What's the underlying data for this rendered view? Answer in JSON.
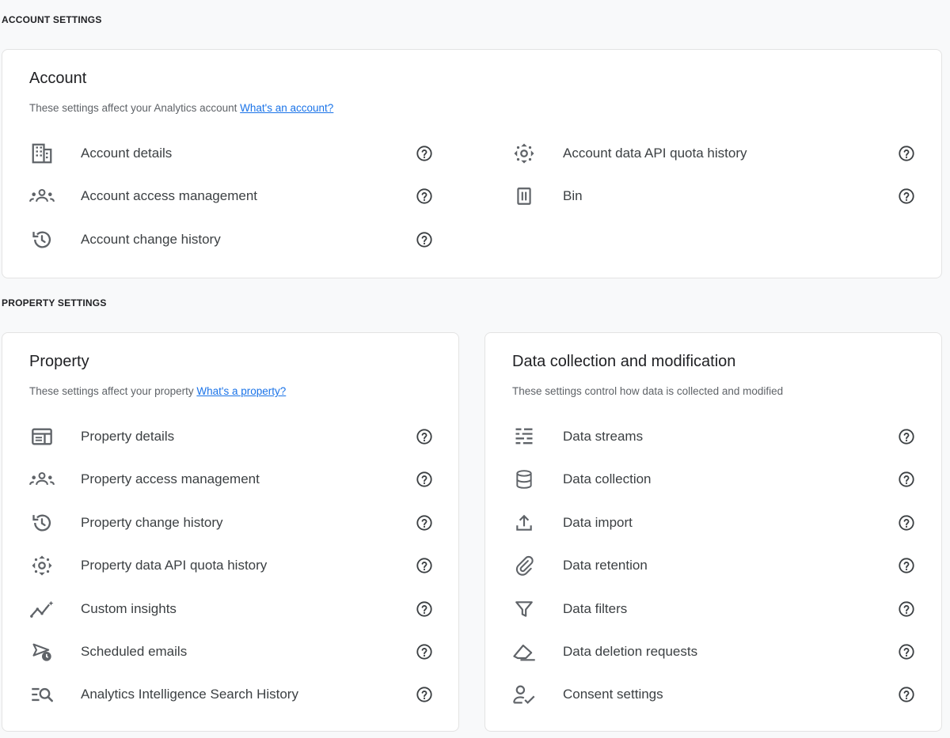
{
  "account_section": {
    "label": "ACCOUNT SETTINGS",
    "card": {
      "title": "Account",
      "subtitle": "These settings affect your Analytics account",
      "link": "What's an account?",
      "left_items": [
        {
          "label": "Account details",
          "icon": "building-icon"
        },
        {
          "label": "Account access management",
          "icon": "people-icon"
        },
        {
          "label": "Account change history",
          "icon": "history-icon"
        }
      ],
      "right_items": [
        {
          "label": "Account data API quota history",
          "icon": "api-quota-icon"
        },
        {
          "label": "Bin",
          "icon": "trash-icon"
        }
      ]
    }
  },
  "property_section": {
    "label": "PROPERTY SETTINGS",
    "property_card": {
      "title": "Property",
      "subtitle": "These settings affect your property",
      "link": "What's a property?",
      "items": [
        {
          "label": "Property details",
          "icon": "property-details-icon"
        },
        {
          "label": "Property access management",
          "icon": "people-icon"
        },
        {
          "label": "Property change history",
          "icon": "history-icon"
        },
        {
          "label": "Property data API quota history",
          "icon": "api-quota-icon"
        },
        {
          "label": "Custom insights",
          "icon": "insights-icon"
        },
        {
          "label": "Scheduled emails",
          "icon": "scheduled-email-icon"
        },
        {
          "label": "Analytics Intelligence Search History",
          "icon": "search-history-icon"
        }
      ]
    },
    "data_card": {
      "title": "Data collection and modification",
      "subtitle": "These settings control how data is collected and modified",
      "items": [
        {
          "label": "Data streams",
          "icon": "data-streams-icon"
        },
        {
          "label": "Data collection",
          "icon": "database-icon"
        },
        {
          "label": "Data import",
          "icon": "upload-icon"
        },
        {
          "label": "Data retention",
          "icon": "paperclip-icon"
        },
        {
          "label": "Data filters",
          "icon": "filter-icon"
        },
        {
          "label": "Data deletion requests",
          "icon": "eraser-icon"
        },
        {
          "label": "Consent settings",
          "icon": "consent-icon"
        }
      ]
    }
  },
  "colors": {
    "link": "#1a73e8",
    "background": "#f8f9fa",
    "card": "#ffffff",
    "text": "#3c4043"
  }
}
